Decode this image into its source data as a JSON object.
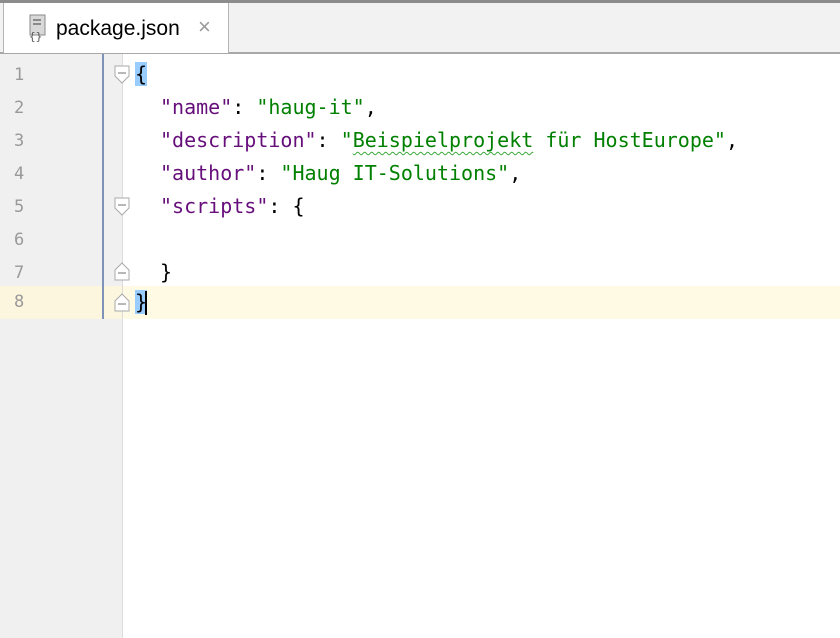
{
  "tab": {
    "title": "package.json",
    "close": "×",
    "icon": "json-file-icon"
  },
  "gutter": {
    "line_numbers": [
      "1",
      "2",
      "3",
      "4",
      "5",
      "6",
      "7",
      "8"
    ]
  },
  "code": {
    "l1": {
      "brace": "{"
    },
    "l2": {
      "key": "\"name\"",
      "sep": ": ",
      "value": "\"haug-it\"",
      "trail": ","
    },
    "l3": {
      "key": "\"description\"",
      "sep": ": ",
      "value_a": "\"",
      "value_w": "Beispielprojekt",
      "value_b": " für HostEurope\"",
      "trail": ","
    },
    "l4": {
      "key": "\"author\"",
      "sep": ": ",
      "value": "\"Haug IT-Solutions\"",
      "trail": ","
    },
    "l5": {
      "key": "\"scripts\"",
      "sep": ": {"
    },
    "l7": {
      "brace": "}"
    },
    "l8": {
      "brace": "}"
    }
  },
  "colors": {
    "key": "#660e7a",
    "string": "#008000",
    "current_line": "#fffae3",
    "brace_match": "#99ccff"
  }
}
